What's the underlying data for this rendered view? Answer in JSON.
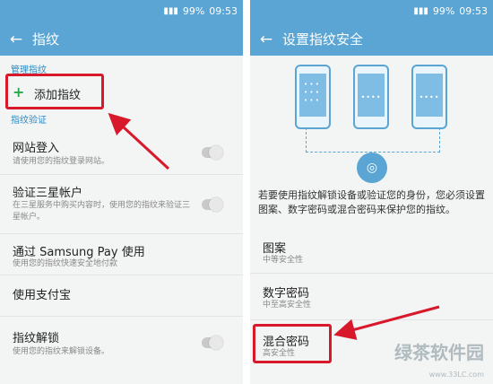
{
  "status": {
    "battery": "99%",
    "time": "09:53"
  },
  "left": {
    "title": "指纹",
    "section_manage": "管理指纹",
    "add_fingerprint": "添加指纹",
    "section_fingerprint_verify": "指纹验证",
    "items": [
      {
        "title": "网站登入",
        "subtitle": "请使用您的指纹登录网站。"
      },
      {
        "title": "验证三星帐户",
        "subtitle": "在三星服务中购买内容时，使用您的指纹来验证三星帐户。"
      },
      {
        "title": "通过 Samsung Pay 使用",
        "subtitle": "使用您的指纹快速安全地付款"
      },
      {
        "title": "使用支付宝",
        "subtitle": ""
      },
      {
        "title": "指纹解锁",
        "subtitle": "使用您的指纹来解锁设备。"
      }
    ]
  },
  "right": {
    "title": "设置指纹安全",
    "description": "若要使用指纹解锁设备或验证您的身份，您必须设置图案、数字密码或混合密码来保护您的指纹。",
    "options": [
      {
        "title": "图案",
        "subtitle": "中等安全性"
      },
      {
        "title": "数字密码",
        "subtitle": "中至高安全性"
      },
      {
        "title": "混合密码",
        "subtitle": "高安全性"
      }
    ]
  },
  "watermark": {
    "brand": "绿茶软件园",
    "url": "www.33LC.com"
  },
  "colors": {
    "header": "#5aa5d3",
    "highlight": "#d8192b",
    "accent": "#2a8ac2"
  },
  "icons": [
    "back-arrow-icon",
    "plus-icon",
    "toggle-switch",
    "fingerprint-icon"
  ]
}
